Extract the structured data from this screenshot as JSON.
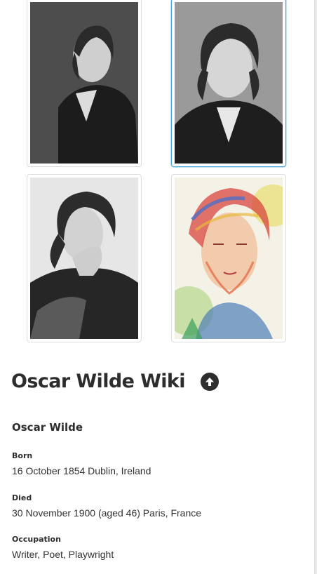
{
  "wiki": {
    "title": "Oscar Wilde Wiki",
    "scroll_top_icon": "arrow-up-circle-icon"
  },
  "gallery": {
    "images": [
      {
        "subject": "Oscar Wilde portrait, profile (black and white photo)"
      },
      {
        "subject": "Oscar Wilde portrait, looking up (black and white photo)",
        "selected": true
      },
      {
        "subject": "Oscar Wilde portrait, hand under chin (black and white photo)"
      },
      {
        "subject": "Oscar Wilde watercolor portrait"
      }
    ]
  },
  "infobox": {
    "name": "Oscar Wilde",
    "fields": [
      {
        "label": "Born",
        "value": "16 October 1854 Dublin, Ireland"
      },
      {
        "label": "Died",
        "value": "30 November 1900 (aged 46) Paris, France"
      },
      {
        "label": "Occupation",
        "value": "Writer, Poet, Playwright"
      }
    ]
  },
  "colors": {
    "accent_border": "#47a6df",
    "title": "#2d2d2d",
    "text": "#333333"
  }
}
